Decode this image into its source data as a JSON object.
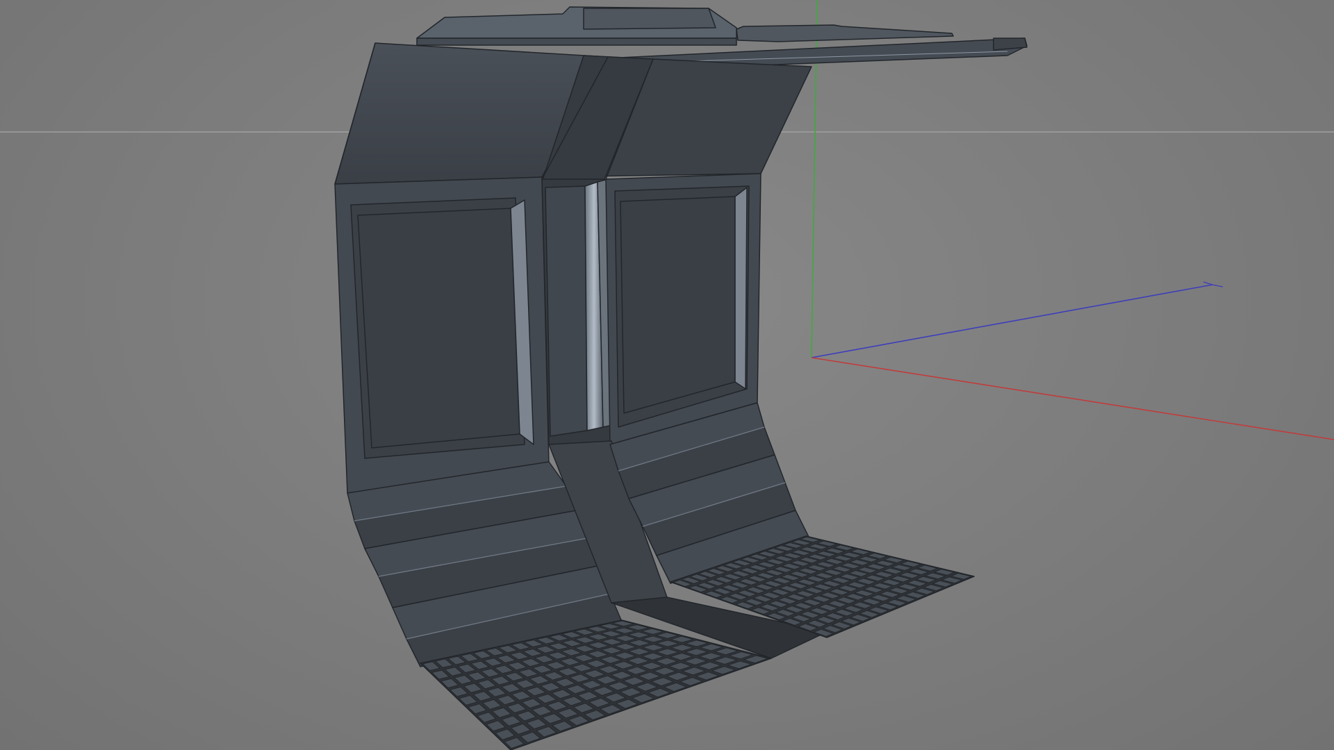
{
  "viewport": {
    "name": "3d-modeling-viewport",
    "background": "#7b7b7b"
  },
  "colors": {
    "model_dark": "#3b4047",
    "model_mid": "#454b53",
    "model_light": "#5a626c",
    "model_highlight": "#8e98a4",
    "grate": "#2e3237",
    "grate_cell": "#4a5058",
    "edge": "#22262b",
    "axis_x": "#c23b3b",
    "axis_y": "#3faa3f",
    "axis_z": "#3d3dbd",
    "horizon": "#a0a0a0"
  },
  "model": {
    "name": "sci-fi-corridor-segment",
    "step_count": 6,
    "grate_rows": 10,
    "grate_cols": 16
  },
  "axes": [
    "x",
    "y",
    "z"
  ]
}
